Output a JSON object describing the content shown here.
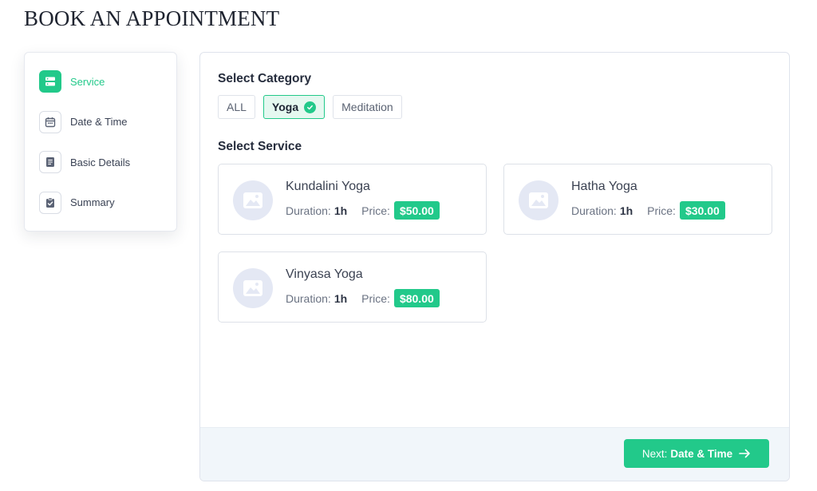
{
  "page": {
    "title": "BOOK AN APPOINTMENT"
  },
  "colors": {
    "accent": "#22c98a",
    "accent_light": "#e5f8f0",
    "footer_bg": "#f1f6fa"
  },
  "steps": [
    {
      "label": "Service",
      "icon": "server-icon",
      "active": true
    },
    {
      "label": "Date & Time",
      "icon": "calendar-icon",
      "active": false
    },
    {
      "label": "Basic Details",
      "icon": "document-icon",
      "active": false
    },
    {
      "label": "Summary",
      "icon": "clipboard-check-icon",
      "active": false
    }
  ],
  "category": {
    "title": "Select Category",
    "options": [
      {
        "label": "ALL",
        "selected": false
      },
      {
        "label": "Yoga",
        "selected": true
      },
      {
        "label": "Meditation",
        "selected": false
      }
    ]
  },
  "service": {
    "title": "Select Service",
    "duration_label": "Duration:",
    "price_label": "Price:",
    "items": [
      {
        "name": "Kundalini Yoga",
        "duration": "1h",
        "price": "$50.00"
      },
      {
        "name": "Hatha Yoga",
        "duration": "1h",
        "price": "$30.00"
      },
      {
        "name": "Vinyasa Yoga",
        "duration": "1h",
        "price": "$80.00"
      }
    ]
  },
  "footer": {
    "next_prefix": "Next:",
    "next_target": "Date & Time"
  }
}
